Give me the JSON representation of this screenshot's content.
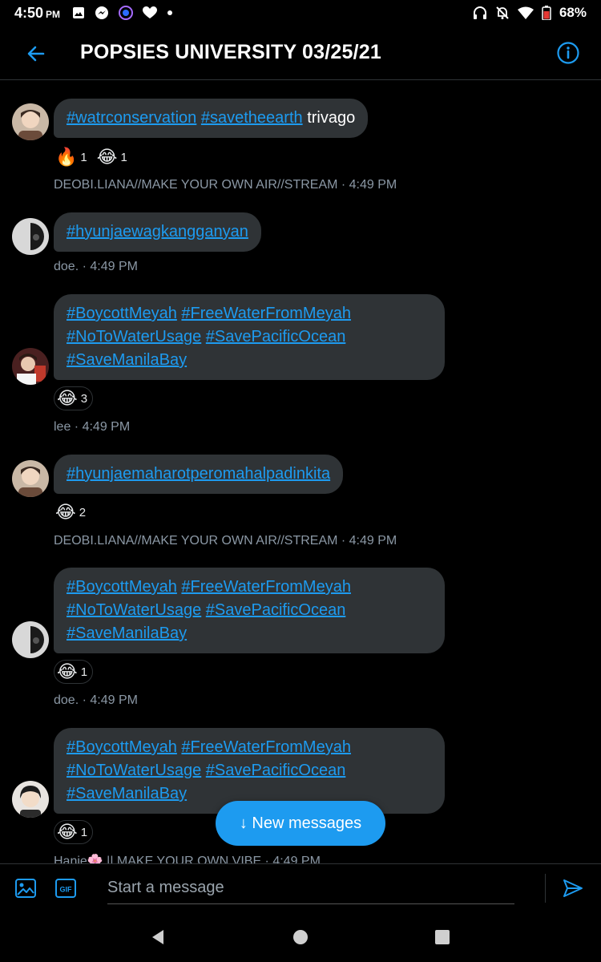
{
  "status_bar": {
    "time": "4:50",
    "ampm": "PM",
    "battery": "68%"
  },
  "header": {
    "title": "POPSIES UNIVERSITY 03/25/21"
  },
  "messages": [
    {
      "text_tags": [
        "#watrconservation",
        "#savetheearth"
      ],
      "text_plain": " trivago",
      "reactions": [
        {
          "emoji": "🔥",
          "count": "1"
        },
        {
          "emoji": "😂",
          "count": "1"
        }
      ],
      "meta": "DEOBI.LIANA//MAKE YOUR OWN AIR//STREAM · 4:49 PM"
    },
    {
      "text_tags": [
        "#hyunjaewagkangganyan"
      ],
      "meta": "doe. · 4:49 PM"
    },
    {
      "text_tags": [
        "#BoycottMeyah",
        "#FreeWaterFromMeyah",
        "#NoToWaterUsage",
        "#SavePacificOcean",
        "#SaveManilaBay"
      ],
      "reactions": [
        {
          "emoji": "😂",
          "count": "3"
        }
      ],
      "meta": "lee · 4:49 PM"
    },
    {
      "text_tags": [
        "#hyunjaemaharotperomahalpadinkita"
      ],
      "reactions": [
        {
          "emoji": "😂",
          "count": "2"
        }
      ],
      "meta": "DEOBI.LIANA//MAKE YOUR OWN AIR//STREAM · 4:49 PM"
    },
    {
      "text_tags": [
        "#BoycottMeyah",
        "#FreeWaterFromMeyah",
        "#NoToWaterUsage",
        "#SavePacificOcean",
        "#SaveManilaBay"
      ],
      "reactions": [
        {
          "emoji": "😂",
          "count": "1"
        }
      ],
      "meta": "doe. · 4:49 PM"
    },
    {
      "text_tags": [
        "#BoycottMeyah",
        "#FreeWaterFromMeyah",
        "#NoToWaterUsage",
        "#SavePacificOcean",
        "#SaveManilaBay"
      ],
      "reactions": [
        {
          "emoji": "😂",
          "count": "1"
        }
      ],
      "meta": "Hanie🌸 || MAKE YOUR OWN VIBE · 4:49 PM"
    }
  ],
  "new_messages_button": "↓ New messages",
  "composer": {
    "placeholder": "Start a message",
    "gif_label": "GIF"
  },
  "colors": {
    "accent": "#1d9bf0",
    "bubble": "#2f3336",
    "meta_text": "#8b98a5",
    "background": "#000000"
  },
  "icons": [
    "back-arrow-icon",
    "info-icon",
    "image-icon",
    "gif-icon",
    "send-icon",
    "nav-back-icon",
    "nav-home-icon",
    "nav-recents-icon"
  ]
}
